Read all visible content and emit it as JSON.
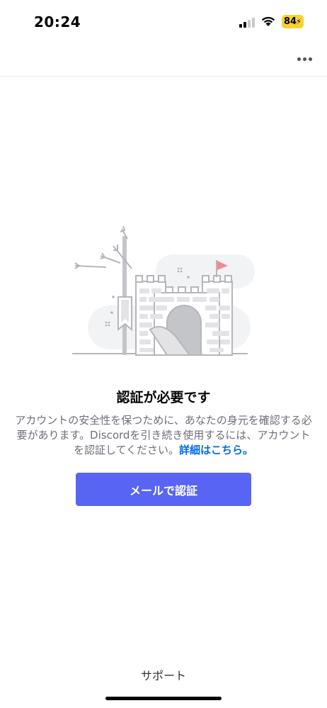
{
  "status_bar": {
    "time": "20:24",
    "battery": "84"
  },
  "header": {
    "more_icon": "ellipsis-icon"
  },
  "illustration": {
    "icon": "castle-illustration",
    "colors": {
      "stone": "#e3e3e6",
      "stone_dark": "#c4c5c9",
      "cloud": "#f2f3f5",
      "flag": "#f5888f",
      "line": "#b5b6bb"
    }
  },
  "content": {
    "title": "認証が必要です",
    "description": "アカウントの安全性を保つために、あなたの身元を確認する必要があります。Discordを引き続き使用するには、アカウントを認証してください。",
    "learn_more": "詳細はこちら。",
    "verify_button": "メールで認証"
  },
  "footer": {
    "support": "サポート"
  },
  "colors": {
    "accent": "#5865f2",
    "link": "#006ce7",
    "battery": "#f7d232"
  }
}
